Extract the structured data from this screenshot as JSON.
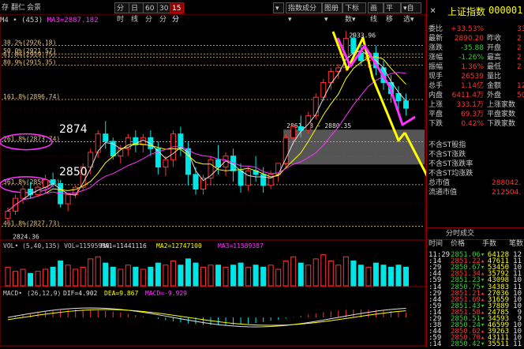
{
  "toolbar": {
    "left": [
      "存",
      "翻仁",
      "会景"
    ],
    "buttons": [
      "分时",
      "日线",
      "60分",
      "30分",
      "15分"
    ],
    "active": "15分",
    "right_buttons": [
      "▾",
      "指数成分▾",
      "图册▾",
      "下标数▾",
      "画线",
      "平移",
      "▾自选▾"
    ],
    "close": "×"
  },
  "ma_line": {
    "label": "M4 • (453)",
    "ma3": "MA3=2887.182"
  },
  "price_labels": {
    "high": "2933.96",
    "f1": "38.2%(2926.18)",
    "f2": "50.0%(2921.57)",
    "f3": "61.8%(2919.75)",
    "f4": "80.9%(2915.35)",
    "f5": "161.8%(2896.74)",
    "f6": "261.8%(2873.74)",
    "f7": "361.8%(2850.42)",
    "f8": "461.8%(2827.73)",
    "low": "2824.36",
    "box": "2861.38 - 2880.35"
  },
  "annotations": {
    "a1": "2874",
    "a2": "2850"
  },
  "vol_line": {
    "vol": "VOL• (5,40,135) VOL=11595939",
    "ma1": "MA1=11441116",
    "ma2": "MA2=12747100",
    "ma3": "MA3=11589387"
  },
  "macd_line": {
    "name": "MACD•",
    "params": "(26,12,9)",
    "dif": "DIF=4.902",
    "dea": "DEA=9.867",
    "macd": "MACD=-9.929"
  },
  "quote": {
    "title": "上证指数",
    "code": "000001",
    "rows": [
      {
        "k1": "委比",
        "v1": "+33.53%",
        "k2": "",
        "v2": "33"
      },
      {
        "k1": "最新",
        "v1": "2890.20",
        "k2": "昨收",
        "v2": "2"
      },
      {
        "k1": "涨跌",
        "v1": "-35.88",
        "k2": "开盘",
        "v2": "2"
      },
      {
        "k1": "涨幅",
        "v1": "-1.26%",
        "k2": "最高",
        "v2": "2"
      },
      {
        "k1": "振幅",
        "v1": "1.36%",
        "k2": "最低",
        "v2": "2"
      },
      {
        "k1": "现手",
        "v1": "26539",
        "k2": "量比",
        "v2": ""
      },
      {
        "k1": "总手",
        "v1": "1.14亿",
        "k2": "金额",
        "v2": "12"
      },
      {
        "k1": "内盘",
        "v1": "6411.4万",
        "k2": "外盘",
        "v2": "5020"
      },
      {
        "k1": "上涨",
        "v1": "333.1万",
        "k2": "上涨家数",
        "v2": ""
      },
      {
        "k1": "平盘",
        "v1": "69.3万",
        "k2": "平盘家数",
        "v2": ""
      },
      {
        "k1": "下跌",
        "v1": "0.42%",
        "k2": "下跌家数",
        "v2": ""
      }
    ],
    "extra": [
      {
        "k": "不含ST股指",
        "v": ""
      },
      {
        "k": "不含ST涨跌",
        "v": ""
      },
      {
        "k": "不含ST涨跌率",
        "v": ""
      },
      {
        "k": "不含ST均涨跌",
        "v": ""
      },
      {
        "k": "总市值",
        "v": "288042."
      },
      {
        "k": "流通市值",
        "v": "212504."
      }
    ]
  },
  "trade_tabs": {
    "t1": "分时成交",
    "header": [
      "时间",
      "价格",
      "手数",
      "笔数"
    ]
  },
  "trades": [
    {
      "t": "11:29",
      "p": "2851.06▾",
      "q": "64128",
      "n": "12"
    },
    {
      "t": ":14",
      "p": "2851.22▴",
      "q": "47611",
      "n": "11"
    },
    {
      "t": ":29",
      "p": "2850.67▾",
      "q": "53450",
      "n": "10"
    },
    {
      "t": ":44",
      "p": "2851.34▴",
      "q": "35792",
      "n": "11"
    },
    {
      "t": ":59",
      "p": "2851.23▾",
      "q": "43098",
      "n": "10"
    },
    {
      "t": ":14",
      "p": "2850.75▾",
      "q": "34383",
      "n": "11"
    },
    {
      "t": ":29",
      "p": "2851.21▴",
      "q": "27036",
      "n": "10"
    },
    {
      "t": ":44",
      "p": "2851.69▴",
      "q": "31659",
      "n": "10"
    },
    {
      "t": ":59",
      "p": "2851.43▾",
      "q": "37889",
      "n": "10"
    },
    {
      "t": ":14",
      "p": "2851.58▴",
      "q": "24785",
      "n": "9"
    },
    {
      "t": ":29",
      "p": "2850.51▾",
      "q": "34593",
      "n": "9"
    },
    {
      "t": ":38",
      "p": "2850.24▾",
      "q": "46599",
      "n": "10"
    },
    {
      "t": ":44",
      "p": "2850.62▴",
      "q": "39263",
      "n": "10"
    },
    {
      "t": ":59",
      "p": "2850.70▴",
      "q": "43111",
      "n": "10"
    },
    {
      "t": ":14",
      "p": "2850.42▾",
      "q": "35511",
      "n": "11"
    }
  ],
  "colors": {
    "up": "#ff3333",
    "down": "#00e5e5",
    "ma_white": "#e0e0e0",
    "ma_yellow": "#ffff00",
    "ma_magenta": "#ff33ff",
    "fib": "#e0c080",
    "box": "#9a9a9a"
  },
  "chart_data": {
    "type": "candlestick",
    "candles": [
      [
        2832,
        2838,
        2836,
        2830
      ],
      [
        2836,
        2845,
        2843,
        2834
      ],
      [
        2843,
        2850,
        2848,
        2840
      ],
      [
        2848,
        2852,
        2845,
        2843
      ],
      [
        2845,
        2850,
        2849,
        2844
      ],
      [
        2849,
        2856,
        2853,
        2846
      ],
      [
        2853,
        2857,
        2851,
        2849
      ],
      [
        2851,
        2853,
        2840,
        2838
      ],
      [
        2840,
        2846,
        2845,
        2836
      ],
      [
        2845,
        2850,
        2849,
        2843
      ],
      [
        2849,
        2862,
        2860,
        2847
      ],
      [
        2860,
        2870,
        2868,
        2856
      ],
      [
        2868,
        2880,
        2878,
        2865
      ],
      [
        2878,
        2885,
        2874,
        2870
      ],
      [
        2874,
        2876,
        2866,
        2864
      ],
      [
        2866,
        2872,
        2870,
        2862
      ],
      [
        2870,
        2878,
        2876,
        2866
      ],
      [
        2876,
        2880,
        2872,
        2868
      ],
      [
        2872,
        2878,
        2876,
        2868
      ],
      [
        2876,
        2880,
        2870,
        2866
      ],
      [
        2870,
        2874,
        2860,
        2856
      ],
      [
        2860,
        2866,
        2864,
        2855
      ],
      [
        2864,
        2880,
        2878,
        2860
      ],
      [
        2878,
        2882,
        2870,
        2866
      ],
      [
        2870,
        2874,
        2856,
        2850
      ],
      [
        2856,
        2860,
        2848,
        2845
      ],
      [
        2848,
        2856,
        2854,
        2845
      ],
      [
        2854,
        2866,
        2864,
        2850
      ],
      [
        2864,
        2872,
        2860,
        2856
      ],
      [
        2860,
        2868,
        2866,
        2855
      ],
      [
        2866,
        2870,
        2858,
        2852
      ],
      [
        2858,
        2862,
        2850,
        2846
      ],
      [
        2850,
        2860,
        2858,
        2847
      ],
      [
        2858,
        2866,
        2856,
        2852
      ],
      [
        2856,
        2860,
        2850,
        2846
      ],
      [
        2850,
        2858,
        2856,
        2848
      ],
      [
        2856,
        2862,
        2862,
        2852
      ],
      [
        2862,
        2878,
        2876,
        2860
      ],
      [
        2876,
        2884,
        2882,
        2872
      ],
      [
        2882,
        2888,
        2880,
        2876
      ],
      [
        2880,
        2890,
        2888,
        2878
      ],
      [
        2888,
        2900,
        2898,
        2886
      ],
      [
        2898,
        2908,
        2906,
        2896
      ],
      [
        2906,
        2914,
        2912,
        2902
      ],
      [
        2912,
        2916,
        2914,
        2908
      ],
      [
        2914,
        2934,
        2930,
        2912
      ],
      [
        2930,
        2933,
        2922,
        2918
      ],
      [
        2922,
        2926,
        2918,
        2915
      ],
      [
        2918,
        2924,
        2922,
        2914
      ],
      [
        2922,
        2926,
        2914,
        2910
      ],
      [
        2914,
        2918,
        2906,
        2902
      ],
      [
        2906,
        2910,
        2900,
        2895
      ],
      [
        2900,
        2904,
        2896,
        2890
      ],
      [
        2896,
        2900,
        2892,
        2888
      ]
    ],
    "volume": [
      9,
      7,
      8,
      6,
      7,
      8,
      9,
      12,
      10,
      8,
      9,
      13,
      14,
      11,
      9,
      8,
      10,
      9,
      8,
      9,
      11,
      10,
      12,
      10,
      13,
      11,
      9,
      10,
      10,
      9,
      10,
      11,
      9,
      10,
      9,
      10,
      8,
      12,
      14,
      11,
      10,
      13,
      15,
      12,
      10,
      14,
      12,
      10,
      9,
      11,
      10,
      9,
      10,
      9
    ],
    "ylim": [
      2822,
      2938
    ]
  }
}
